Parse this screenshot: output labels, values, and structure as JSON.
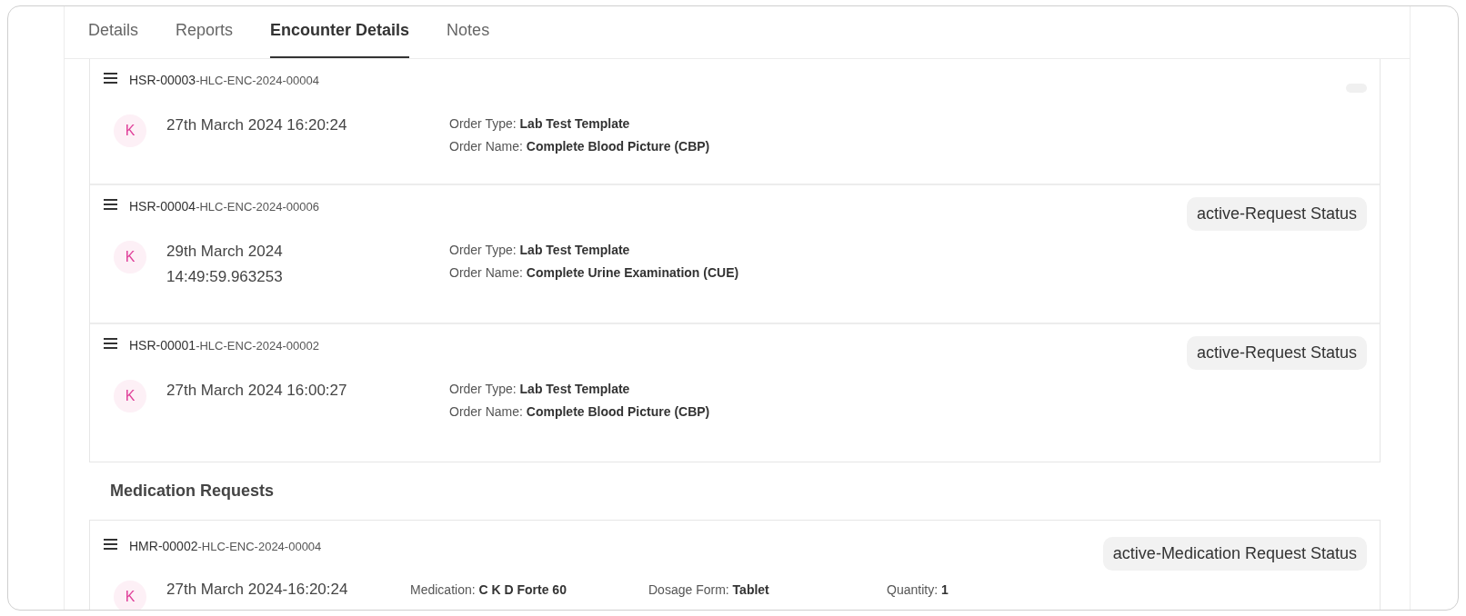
{
  "tabs": [
    {
      "label": "Details",
      "selected": false
    },
    {
      "label": "Reports",
      "selected": false
    },
    {
      "label": "Encounter Details",
      "selected": true
    },
    {
      "label": "Notes",
      "selected": false
    }
  ],
  "service_requests": [
    {
      "id": "HSR-00003",
      "encounter": "-HLC-ENC-2024-00004",
      "badge": {
        "kind": "empty"
      },
      "avatar": "K",
      "date": [
        "27th March 2024 16:20:24"
      ],
      "fields": [
        {
          "label": "Order Type:",
          "value": "Lab Test Template"
        },
        {
          "label": "Order Name:",
          "value": "Complete Blood Picture (CBP)"
        }
      ]
    },
    {
      "id": "HSR-00004",
      "encounter": "-HLC-ENC-2024-00006",
      "badge": {
        "kind": "text",
        "text": "active-Request Status"
      },
      "avatar": "K",
      "date": [
        "29th March 2024",
        "14:49:59.963253"
      ],
      "fields": [
        {
          "label": "Order Type:",
          "value": "Lab Test Template"
        },
        {
          "label": "Order Name:",
          "value": "Complete Urine Examination (CUE)"
        }
      ]
    },
    {
      "id": "HSR-00001",
      "encounter": "-HLC-ENC-2024-00002",
      "badge": {
        "kind": "text",
        "text": "active-Request Status"
      },
      "avatar": "K",
      "date": [
        "27th March 2024 16:00:27"
      ],
      "fields": [
        {
          "label": "Order Type:",
          "value": "Lab Test Template"
        },
        {
          "label": "Order Name:",
          "value": "Complete Blood Picture (CBP)"
        }
      ]
    }
  ],
  "medication_section": {
    "title": "Medication Requests",
    "requests": [
      {
        "id": "HMR-00002",
        "encounter": "-HLC-ENC-2024-00004",
        "badge": {
          "kind": "text",
          "text": "active-Medication Request Status"
        },
        "avatar": "K",
        "date": "27th March 2024-16:20:24",
        "fields": [
          {
            "label": "Medication:",
            "value": "C K D Forte 60"
          },
          {
            "label": "Dosage Form:",
            "value": "Tablet"
          },
          {
            "label": "Quantity:",
            "value": "1"
          }
        ]
      }
    ]
  }
}
